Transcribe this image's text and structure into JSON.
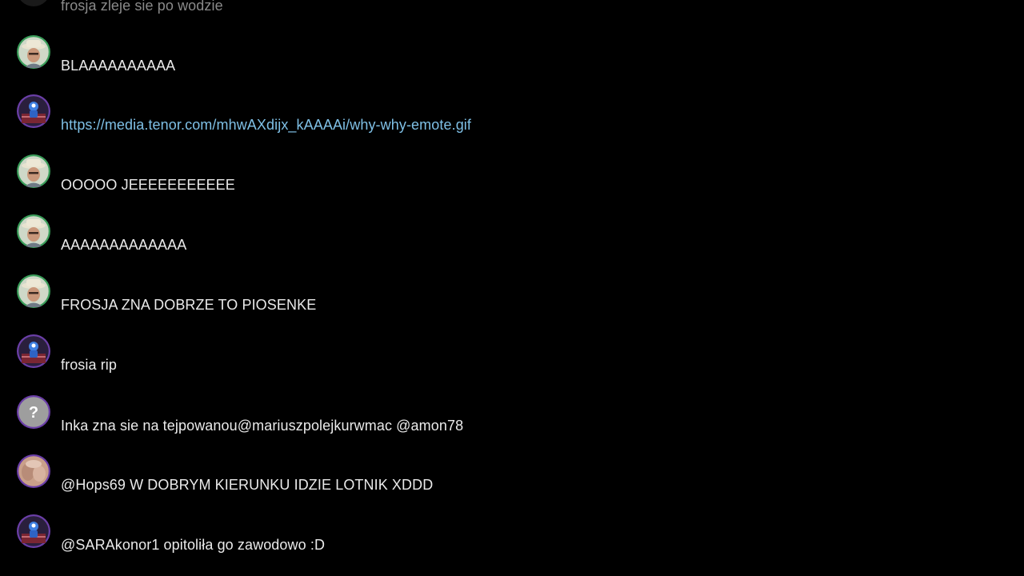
{
  "colors": {
    "background": "#000000",
    "text": "#eaeaea",
    "link": "#7fc0e6",
    "avatar_ring_green": "#3a9d5a",
    "avatar_ring_purple": "#6b3fa8"
  },
  "messages": [
    {
      "text": "frosja zleje sie po wodzie",
      "avatar": "partial-avatar"
    },
    {
      "text": "BLAAAAAAAAAA",
      "avatar": "man-with-hat-avatar"
    },
    {
      "text": "https://media.tenor.com/mhwAXdijx_kAAAAi/why-why-emote.gif",
      "avatar": "blue-character-avatar",
      "is_link": true
    },
    {
      "text": "OOOOO JEEEEEEEEEEE",
      "avatar": "man-with-hat-avatar"
    },
    {
      "text": "AAAAAAAAAAAAA",
      "avatar": "man-with-hat-avatar"
    },
    {
      "text": "FROSJA ZNA DOBRZE TO PIOSENKE",
      "avatar": "man-with-hat-avatar"
    },
    {
      "text": "frosia rip",
      "avatar": "blue-character-avatar"
    },
    {
      "text": "Inka zna sie na tejpowanou@mariuszpolejkurwmac @amon78",
      "avatar": "question-mark-avatar"
    },
    {
      "text": "@Hops69 W DOBRYM KIERUNKU IDZIE LOTNIK XDDD",
      "avatar": "blurred-photo-avatar"
    },
    {
      "text": "@SARAkonor1 opitoliła go zawodowo :D",
      "avatar": "blue-character-avatar"
    }
  ]
}
